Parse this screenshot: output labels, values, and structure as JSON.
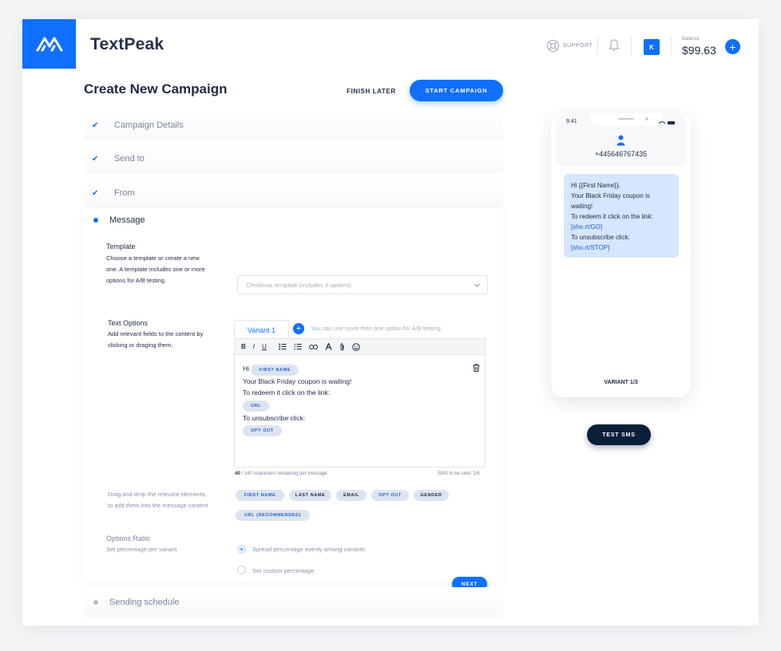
{
  "app": {
    "brand": "TextPeak"
  },
  "header": {
    "support_label": "SUPPORT",
    "avatar_initial": "K",
    "balance_label": "Balance",
    "balance_value": "$99.63"
  },
  "page": {
    "title": "Create New Campaign",
    "finish_later": "FINISH LATER",
    "start_campaign": "START CAMPAIGN"
  },
  "steps": [
    {
      "label": "Campaign Details",
      "state": "done"
    },
    {
      "label": "Send to",
      "state": "done"
    },
    {
      "label": "From",
      "state": "done"
    },
    {
      "label": "Message",
      "state": "active"
    },
    {
      "label": "Sending schedule",
      "state": "pending"
    }
  ],
  "message": {
    "template_label": "Template",
    "template_desc": [
      "Choose a template or create a new",
      "one. A template includes one or more",
      "options for A/B testing."
    ],
    "template_select": "Christmas template (includes 3 options)",
    "text_options_label": "Text Options",
    "text_options_desc": [
      "Add relevant fields to the content by",
      "clicking or draging them."
    ],
    "variant_tab": "Variant 1",
    "variant_hint": "You can use more then one option for A/B testing",
    "toolbar": {
      "bold": "B",
      "italic": "I",
      "underline": "U"
    },
    "editor": {
      "hi": "Hi",
      "chip_first_name": "FIRST NAME",
      "line1": "Your Black Friday coupon is waiting!",
      "line2": "To redeem it click on the link:",
      "chip_url": "URL",
      "line3": "To unsubscribe click:",
      "chip_opt_out": "OPT OUT"
    },
    "counter_num": "40",
    "counter_rest": " / 140 characters remaining per message",
    "sms_count": "SMS to be sent: 1/6",
    "drag_desc": [
      "Drag and drop the relevant elements,",
      "to add them into the message content"
    ],
    "fields": [
      "FIRST NAME",
      "LAST NAME",
      "EMAIL",
      "OPT OUT",
      "GENDER",
      "URL (RECOMMENDED)"
    ],
    "ratio_label": "Options Ratio",
    "ratio_desc": "Set percentage per variant",
    "ratio_options": [
      "Spread percentage evenly among variants",
      "Set custom percentage"
    ],
    "ratio_selected": 0,
    "next": "NEXT"
  },
  "preview": {
    "time": "9:41",
    "number": "+445646767435",
    "bubble": [
      "Hi {{First Name}},",
      "Your Black Friday coupon is",
      "waiting!",
      "To redeem it click on the link:",
      "[sho.rt/GO]",
      "To unsubscribe click:",
      "[sho.rt/STOP]"
    ],
    "variant": "VARIANT 1/3",
    "test_sms": "TEST SMS"
  },
  "colors": {
    "accent": "#0f6fff",
    "dark": "#0b1e3a",
    "chip": "#dde4f1",
    "bubble": "#d6e6ff"
  }
}
